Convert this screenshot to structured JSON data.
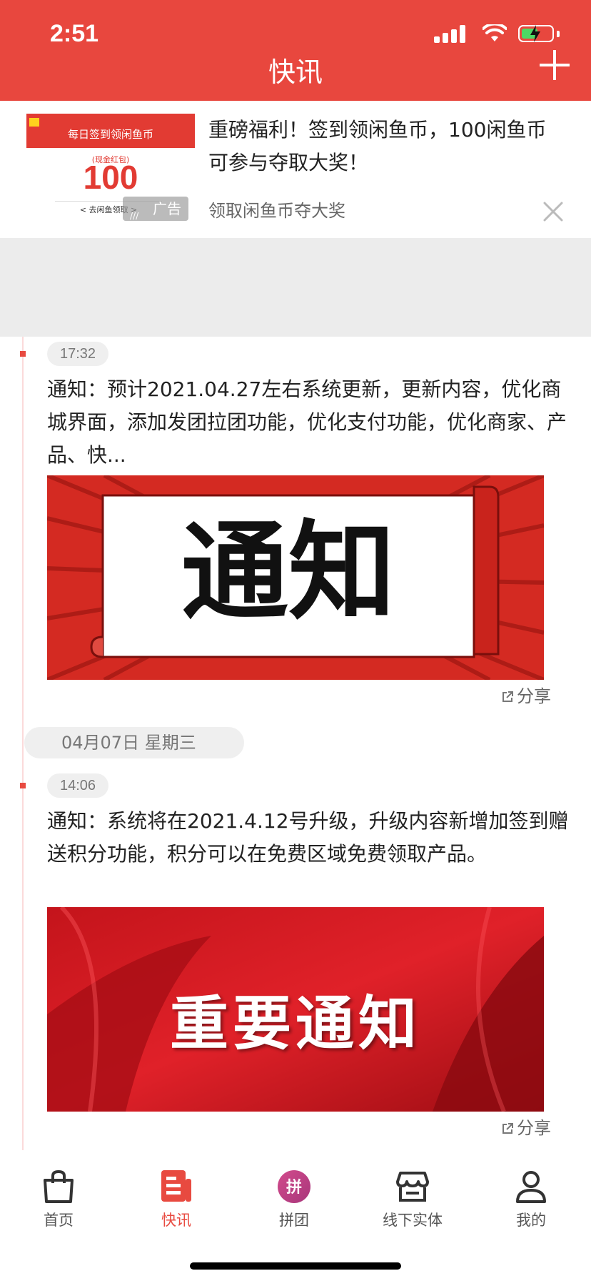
{
  "status_bar": {
    "time": "2:51",
    "battery_level": 0.55
  },
  "header": {
    "title": "快讯",
    "accent": "#e8473e"
  },
  "ad": {
    "image": {
      "header": "每日签到领闲鱼币",
      "sub": "(现金红包)",
      "amount": "100",
      "button": "< 去闲鱼领取 >"
    },
    "badge": "广告",
    "title": "重磅福利！签到领闲鱼币，100闲鱼币可参与夺取大奖！",
    "subtitle": "领取闲鱼币夺大奖"
  },
  "feed": {
    "posts": [
      {
        "time": "17:32",
        "text": "通知：预计2021.04.27左右系统更新，更新内容，优化商城界面，添加发团拉团功能，优化支付功能，优化商家、产品、快...",
        "image_text": "通知",
        "share": "分享"
      },
      {
        "time": "14:06",
        "text": "通知：系统将在2021.4.12号升级，升级内容新增加签到赠送积分功能，积分可以在免费区域免费领取产品。",
        "image_text": "重要通知",
        "share": "分享"
      }
    ],
    "date_separator": "04月07日  星期三"
  },
  "tabs": [
    {
      "label": "首页",
      "icon": "shopping-bag-icon",
      "active": false
    },
    {
      "label": "快讯",
      "icon": "news-icon",
      "active": true
    },
    {
      "label": "拼团",
      "icon": "group-buy-icon",
      "active": false
    },
    {
      "label": "线下实体",
      "icon": "store-icon",
      "active": false
    },
    {
      "label": "我的",
      "icon": "user-icon",
      "active": false
    }
  ]
}
